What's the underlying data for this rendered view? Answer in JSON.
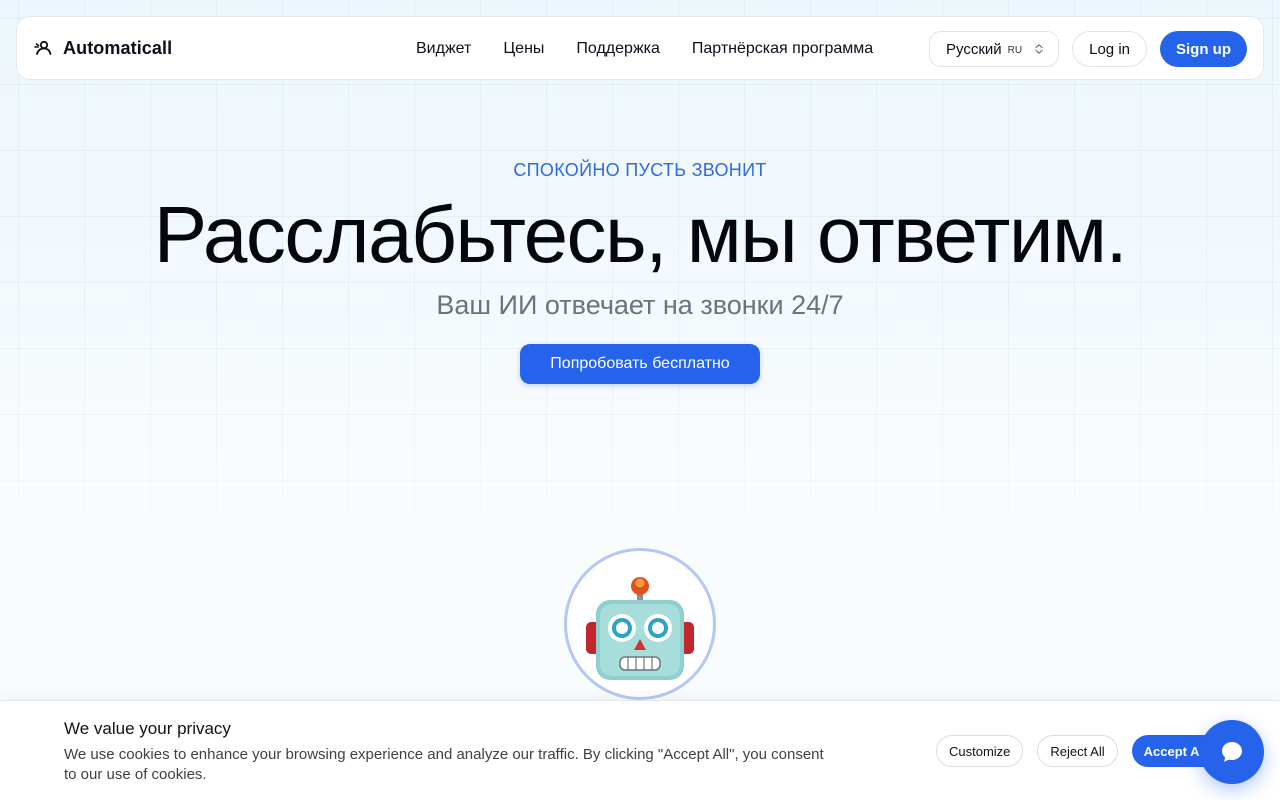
{
  "brand": {
    "name": "Automaticall",
    "logo_icon": "agent-logo-icon"
  },
  "nav": {
    "links": [
      "Виджет",
      "Цены",
      "Поддержка",
      "Партнёрская программа"
    ],
    "language": {
      "label": "Русский",
      "code": "RU"
    },
    "login_label": "Log in",
    "signup_label": "Sign up"
  },
  "hero": {
    "eyebrow": "СПОКОЙНО ПУСТЬ ЗВОНИТ",
    "title": "Расслабьтесь, мы ответим.",
    "subtitle": "Ваш ИИ отвечает на звонки 24/7",
    "cta_label": "Попробовать бесплатно"
  },
  "avatar": {
    "icon": "robot-face-icon"
  },
  "cookie": {
    "title": "We value your privacy",
    "text": "We use cookies to enhance your browsing experience and analyze our traffic. By clicking \"Accept All\", you consent to our use of cookies.",
    "customize_label": "Customize",
    "reject_label": "Reject All",
    "accept_label": "Accept All"
  },
  "chat": {
    "icon": "chat-bubble-icon"
  },
  "colors": {
    "accent": "#2563eb",
    "eyebrow": "#2f6ae0",
    "subtitle": "#6b7280"
  }
}
